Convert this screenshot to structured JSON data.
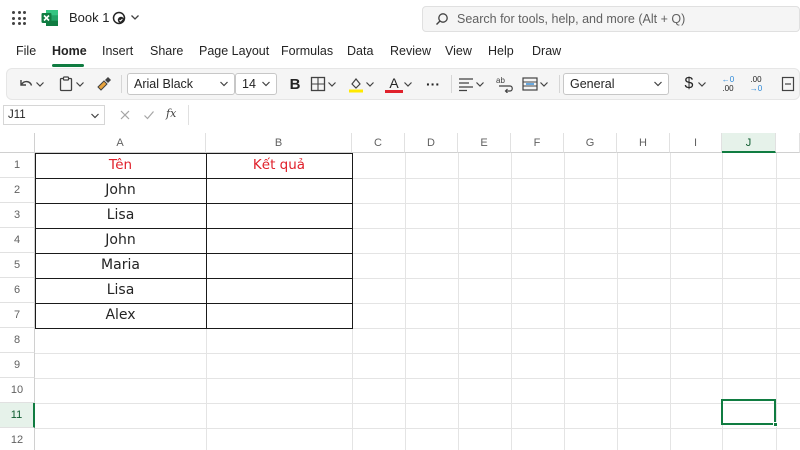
{
  "app": {
    "title": "Book 1",
    "brand_color": "#107c41",
    "icons": [
      "app-launcher-icon",
      "excel-logo-icon",
      "sync-status-icon",
      "chevron-down-icon",
      "search-icon"
    ]
  },
  "search": {
    "placeholder": "Search for tools, help, and more (Alt + Q)"
  },
  "menu": {
    "tabs": [
      {
        "label": "File",
        "active": false
      },
      {
        "label": "Home",
        "active": true
      },
      {
        "label": "Insert",
        "active": false
      },
      {
        "label": "Share",
        "active": false
      },
      {
        "label": "Page Layout",
        "active": false
      },
      {
        "label": "Formulas",
        "active": false
      },
      {
        "label": "Data",
        "active": false
      },
      {
        "label": "Review",
        "active": false
      },
      {
        "label": "View",
        "active": false
      },
      {
        "label": "Help",
        "active": false
      },
      {
        "label": "Draw",
        "active": false
      }
    ]
  },
  "ribbon": {
    "font_name": "Arial Black",
    "font_size": "14",
    "number_format": "General",
    "bold_label": "B",
    "font_color_label": "A",
    "highlight_color": "#ffe900",
    "font_color": "#e0212b",
    "increase_decimal_top": "←0",
    "increase_decimal_bottom": ".00",
    "decrease_decimal_top": ".00",
    "decrease_decimal_bottom": "→0",
    "currency_label": "$",
    "more_label": "···",
    "icons": [
      "undo-icon",
      "paste-icon",
      "format-painter-icon",
      "borders-icon",
      "fill-color-icon",
      "font-color-icon",
      "more-options-icon",
      "align-icon",
      "wrap-text-icon",
      "merge-cells-icon",
      "currency-icon",
      "increase-decimal-icon",
      "decrease-decimal-icon",
      "overflow-icon"
    ]
  },
  "formula_bar": {
    "name_box": "J11",
    "fx_label": "fx",
    "value": ""
  },
  "sheet": {
    "columns": [
      "A",
      "B",
      "C",
      "D",
      "E",
      "F",
      "G",
      "H",
      "I",
      "J"
    ],
    "rows": [
      "1",
      "2",
      "3",
      "4",
      "5",
      "6",
      "7",
      "8",
      "9",
      "10",
      "11",
      "12"
    ],
    "selected_column": "J",
    "selected_row": "11",
    "active_cell": "J11",
    "header_text_color": "#e0212b",
    "table": {
      "headers": [
        "Tên",
        "Kết quả"
      ],
      "names": [
        "John",
        "Lisa",
        "John",
        "Maria",
        "Lisa",
        "Alex"
      ],
      "results": [
        "",
        "",
        "",
        "",
        "",
        ""
      ]
    }
  }
}
